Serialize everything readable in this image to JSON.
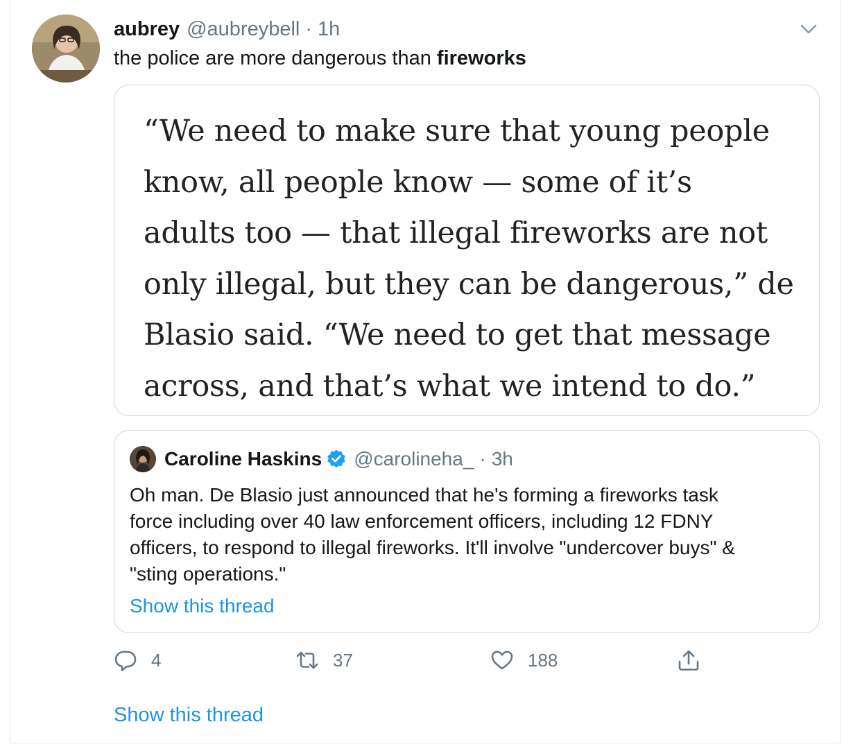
{
  "tweet": {
    "display_name": "aubrey",
    "handle": "@aubreybell",
    "separator": "·",
    "time": "1h",
    "text_before": "the police are more dangerous than ",
    "text_highlight": "fireworks"
  },
  "media": {
    "quote_lines": [
      "“We need to make sure that young people",
      "know, all people know — some of it’s",
      "adults too — that illegal fireworks are not",
      "only illegal, but they can be dangerous,” de",
      "Blasio said. “We need to get that message",
      "across, and that’s what we intend to do.”"
    ]
  },
  "quoted_tweet": {
    "display_name": "Caroline Haskins",
    "verified": true,
    "handle": "@carolineha_",
    "separator": "·",
    "time": "3h",
    "text_lines": [
      "Oh man. De Blasio just announced that he's forming a fireworks task",
      "force including over 40 law enforcement officers, including 12 FDNY",
      "officers, to respond to illegal fireworks. It'll involve \"undercover buys\" &",
      "\"sting operations.\""
    ],
    "show_thread": "Show this thread"
  },
  "actions": {
    "reply_count": "4",
    "retweet_count": "37",
    "like_count": "188",
    "icons": [
      "reply-icon",
      "retweet-icon",
      "like-icon",
      "share-icon"
    ]
  },
  "show_thread": "Show this thread",
  "colors": {
    "link": "#1b95e0",
    "secondary_text": "#657786",
    "border": "#ccd6dd",
    "verified": "#1da1f2"
  }
}
